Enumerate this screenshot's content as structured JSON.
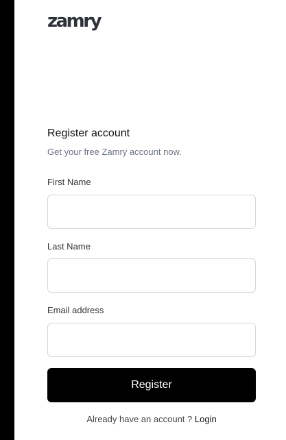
{
  "brand": {
    "logo_text": "zamry"
  },
  "form": {
    "title": "Register account",
    "subtitle": "Get your free Zamry account now.",
    "fields": {
      "first_name": {
        "label": "First Name",
        "value": "",
        "placeholder": ""
      },
      "last_name": {
        "label": "Last Name",
        "value": "",
        "placeholder": ""
      },
      "email": {
        "label": "Email address",
        "value": "",
        "placeholder": ""
      }
    },
    "submit_label": "Register"
  },
  "footer": {
    "prompt": "Already have an account ? ",
    "login_label": "Login"
  },
  "colors": {
    "sidebar": "#000000",
    "button_bg": "#000000",
    "button_text": "#ffffff",
    "input_border": "#d5d7db",
    "subtitle_text": "#6b7280"
  }
}
